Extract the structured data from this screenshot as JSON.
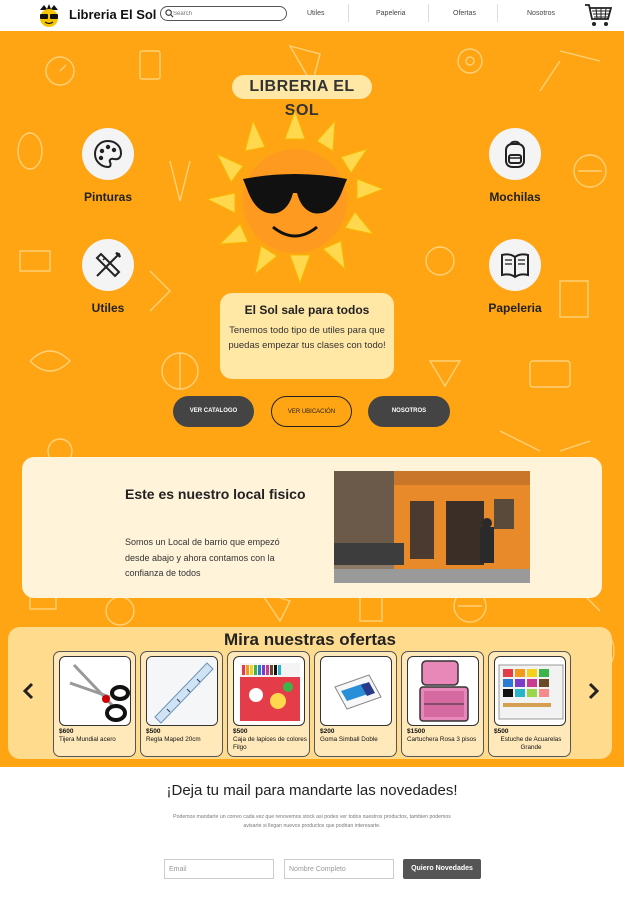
{
  "brand": {
    "name": "Libreria El Sol"
  },
  "search": {
    "placeholder": "Search"
  },
  "nav": {
    "links": [
      "Utiles",
      "Papeleria",
      "Ofertas",
      "Nosotros"
    ]
  },
  "hero": {
    "title": "LIBRERIA EL SOL",
    "categories": [
      "Pinturas",
      "Mochilas",
      "Utiles",
      "Papeleria"
    ],
    "promo_title": "El Sol sale para todos",
    "promo_text": "Tenemos todo tipo de utiles para que puedas empezar tus clases con todo!",
    "buttons": [
      "VER CATALOGO",
      "VER UBICACIÓN",
      "NOSOTROS"
    ]
  },
  "local": {
    "title": "Este es nuestro local fisico",
    "text": "Somos un Local de barrio que empezó desde abajo y ahora contamos con la confianza de todos"
  },
  "offers": {
    "title": "Mira nuestras ofertas",
    "items": [
      {
        "price": "$600",
        "name": "Tijera Mundial acero"
      },
      {
        "price": "$500",
        "name": "Regla Maped 20cm"
      },
      {
        "price": "$500",
        "name": "Caja de lapices de colores Filgo"
      },
      {
        "price": "$200",
        "name": "Goma Simball Doble"
      },
      {
        "price": "$1500",
        "name": "Cartuchera Rosa 3 pisos"
      },
      {
        "price": "$500",
        "name": "Estuche de Acuarelas Grande"
      }
    ]
  },
  "newsletter": {
    "title": "¡Deja tu mail para mandarte las novedades!",
    "text": "Podemos mandarte un correo cada vez que renovemos stock asi podes ver todos nuestros productos, tambien podemos avisarte si llegan nuevos productos que podrian interesarte.",
    "email_placeholder": "Email",
    "name_placeholder": "Nombre Completo",
    "button": "Quiero Novedades"
  },
  "colors": {
    "hero_bg": "#ffa514",
    "panel": "#ffe7a6",
    "dark_button": "#444444"
  }
}
